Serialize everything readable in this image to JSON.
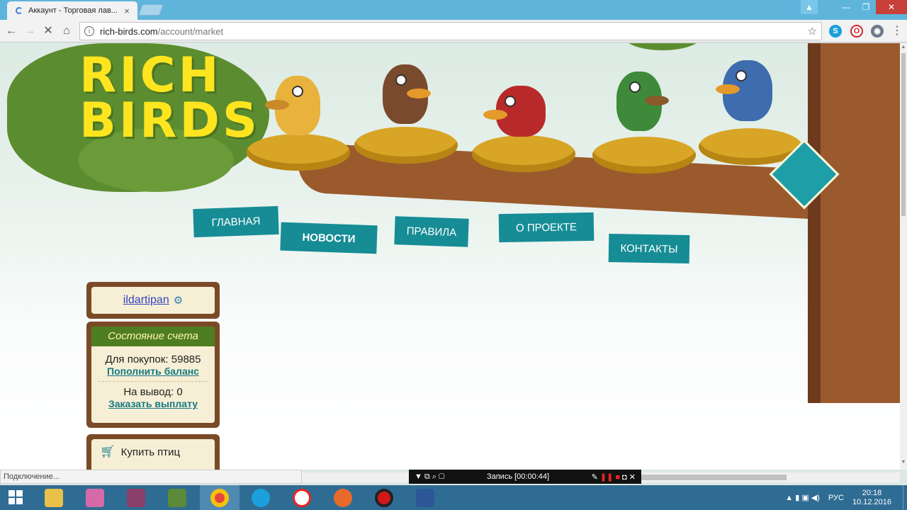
{
  "browser": {
    "tab_title": "Аккаунт - Торговая лав...",
    "url_host": "rich-birds.com",
    "url_path": "/account/market",
    "status_text": "Подключение..."
  },
  "site": {
    "logo_line1": "RICH",
    "logo_line2": "BIRDS",
    "nav": [
      "ГЛАВНАЯ",
      "НОВОСТИ",
      "ПРАВИЛА",
      "О ПРОЕКТЕ",
      "КОНТАКТЫ"
    ]
  },
  "sidebar": {
    "username": "ildartipan",
    "account_title": "Состояние счета",
    "purchases_label": "Для покупок: 59885",
    "topup_link": "Пополнить баланс",
    "withdraw_label": "На вывод: 0",
    "payout_link": "Заказать выплату",
    "buy_birds": "Купить птиц"
  },
  "recorder": {
    "title": "Запись [00:00:44]"
  },
  "taskbar": {
    "lang": "РУС",
    "time": "20:18",
    "date": "10.12.2016"
  },
  "colors": {
    "nav_tag": "#168c95",
    "logo_yellow": "#ffe51f",
    "tree_green": "#5c8c30",
    "wood": "#7a4a27"
  }
}
